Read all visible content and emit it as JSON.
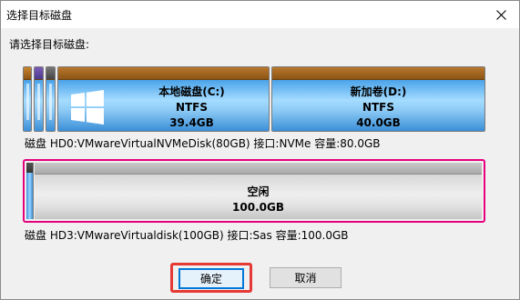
{
  "dialog": {
    "title": "选择目标磁盘",
    "prompt": "请选择目标磁盘:"
  },
  "disks": [
    {
      "info": "磁盘 HD0:VMwareVirtualNVMeDisk(80GB)  接口:NVMe  容量:80.0GB",
      "partitions": [
        {
          "name": "本地磁盘(C:)",
          "fs": "NTFS",
          "size": "39.4GB"
        },
        {
          "name": "新加卷(D:)",
          "fs": "NTFS",
          "size": "40.0GB"
        }
      ]
    },
    {
      "info": "磁盘 HD3:VMwareVirtualdisk(100GB)  接口:Sas  容量:100.0GB",
      "partitions": [
        {
          "name": "空闲",
          "size": "100.0GB"
        }
      ]
    }
  ],
  "buttons": {
    "ok": "确定",
    "cancel": "取消"
  },
  "icons": {
    "close": "close-icon",
    "windows": "windows-logo-icon"
  },
  "colors": {
    "partition_cap": "#a0641e",
    "partition_body": "#7fc3f5",
    "selection_border": "#e6007e",
    "highlight_box": "#e53935",
    "focus_border": "#0078d7"
  }
}
